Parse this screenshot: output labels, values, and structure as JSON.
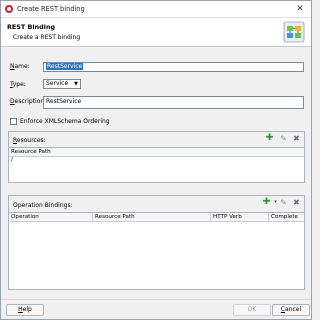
{
  "window": {
    "title": "Create REST binding",
    "close_glyph": "✕"
  },
  "header": {
    "title": "REST Binding",
    "subtitle": "Create a REST binding",
    "graphic_icon": "rest-binding-wizard-icon"
  },
  "form": {
    "name_label_mnemonic": "N",
    "name_label_rest": "ame:",
    "name_value": "RestService",
    "type_label_mnemonic": "T",
    "type_label_rest": "ype:",
    "type_value": "Service",
    "description_label_mnemonic": "D",
    "description_label_rest": "escription:",
    "description_value": "RestService",
    "enforce_label": "Enforce XMLSchema Ordering",
    "enforce_checked": false
  },
  "resources": {
    "title_mnemonic": "R",
    "title_rest": "esources:",
    "columns": [
      "Resource Path"
    ],
    "rows": [
      [
        "/"
      ]
    ]
  },
  "operations": {
    "title": "Operation Bindings:",
    "columns": [
      "Operation",
      "Resource Path",
      "HTTP Verb",
      "Complete"
    ],
    "rows": []
  },
  "footer": {
    "help_mnemonic": "H",
    "help_rest": "elp",
    "ok_label": "OK",
    "cancel_mnemonic": "C",
    "cancel_rest": "ancel"
  },
  "colors": {
    "accent": "#3174c6",
    "add_green": "#1f9a2f",
    "oracle_red": "#c8202f"
  }
}
